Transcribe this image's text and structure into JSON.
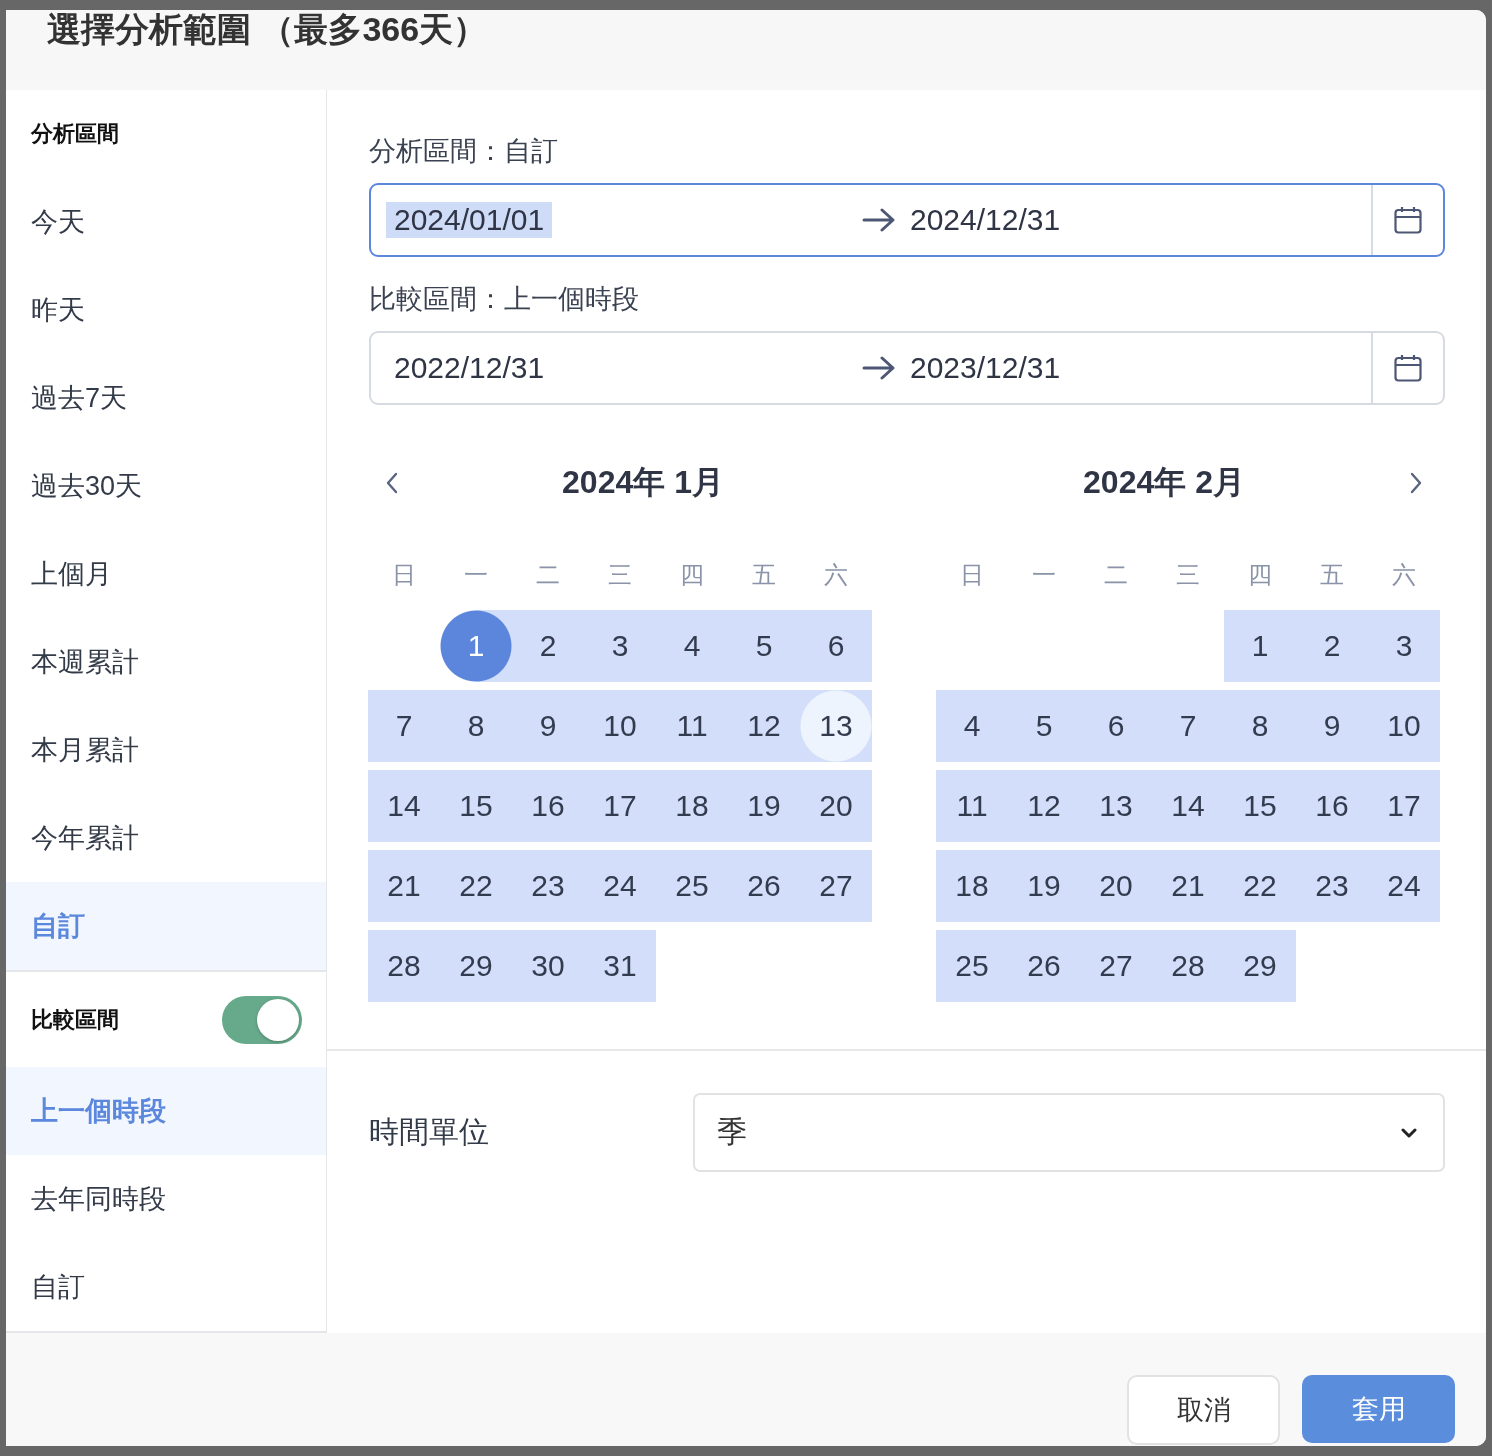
{
  "dialog": {
    "title": "選擇分析範圍 （最多366天）"
  },
  "sidebar": {
    "sections": [
      {
        "heading": "分析區間",
        "items": [
          {
            "label": "今天",
            "selected": false
          },
          {
            "label": "昨天",
            "selected": false
          },
          {
            "label": "過去7天",
            "selected": false
          },
          {
            "label": "過去30天",
            "selected": false
          },
          {
            "label": "上個月",
            "selected": false
          },
          {
            "label": "本週累計",
            "selected": false
          },
          {
            "label": "本月累計",
            "selected": false
          },
          {
            "label": "今年累計",
            "selected": false
          },
          {
            "label": "自訂",
            "selected": true
          }
        ]
      },
      {
        "heading": "比較區間",
        "toggle": {
          "on": true
        },
        "items": [
          {
            "label": "上一個時段",
            "selected": true
          },
          {
            "label": "去年同時段",
            "selected": false
          },
          {
            "label": "自訂",
            "selected": false
          }
        ]
      }
    ]
  },
  "ranges": [
    {
      "label": "分析區間：自訂",
      "start": "2024/01/01",
      "end": "2024/12/31",
      "focused": true,
      "start_selected": true
    },
    {
      "label": "比較區間：上一個時段",
      "start": "2022/12/31",
      "end": "2023/12/31",
      "focused": false,
      "start_selected": false
    }
  ],
  "calendars": [
    {
      "title": "2024年 1月",
      "weekdays": [
        "日",
        "一",
        "二",
        "三",
        "四",
        "五",
        "六"
      ],
      "weeks": [
        {
          "kind": "first",
          "days": [
            {
              "day": "1",
              "in_range": true,
              "selected": true,
              "hovered": false
            },
            {
              "day": "2",
              "in_range": true,
              "selected": false,
              "hovered": false
            },
            {
              "day": "3",
              "in_range": true,
              "selected": false,
              "hovered": false
            },
            {
              "day": "4",
              "in_range": true,
              "selected": false,
              "hovered": false
            },
            {
              "day": "5",
              "in_range": true,
              "selected": false,
              "hovered": false
            },
            {
              "day": "6",
              "in_range": true,
              "selected": false,
              "hovered": false
            }
          ]
        },
        {
          "kind": "middle",
          "days": [
            {
              "day": "7",
              "in_range": true,
              "selected": false,
              "hovered": false
            },
            {
              "day": "8",
              "in_range": true,
              "selected": false,
              "hovered": false
            },
            {
              "day": "9",
              "in_range": true,
              "selected": false,
              "hovered": false
            },
            {
              "day": "10",
              "in_range": true,
              "selected": false,
              "hovered": false
            },
            {
              "day": "11",
              "in_range": true,
              "selected": false,
              "hovered": false
            },
            {
              "day": "12",
              "in_range": true,
              "selected": false,
              "hovered": false
            },
            {
              "day": "13",
              "in_range": true,
              "selected": false,
              "hovered": true
            }
          ]
        },
        {
          "kind": "middle",
          "days": [
            {
              "day": "14",
              "in_range": true,
              "selected": false,
              "hovered": false
            },
            {
              "day": "15",
              "in_range": true,
              "selected": false,
              "hovered": false
            },
            {
              "day": "16",
              "in_range": true,
              "selected": false,
              "hovered": false
            },
            {
              "day": "17",
              "in_range": true,
              "selected": false,
              "hovered": false
            },
            {
              "day": "18",
              "in_range": true,
              "selected": false,
              "hovered": false
            },
            {
              "day": "19",
              "in_range": true,
              "selected": false,
              "hovered": false
            },
            {
              "day": "20",
              "in_range": true,
              "selected": false,
              "hovered": false
            }
          ]
        },
        {
          "kind": "middle",
          "days": [
            {
              "day": "21",
              "in_range": true,
              "selected": false,
              "hovered": false
            },
            {
              "day": "22",
              "in_range": true,
              "selected": false,
              "hovered": false
            },
            {
              "day": "23",
              "in_range": true,
              "selected": false,
              "hovered": false
            },
            {
              "day": "24",
              "in_range": true,
              "selected": false,
              "hovered": false
            },
            {
              "day": "25",
              "in_range": true,
              "selected": false,
              "hovered": false
            },
            {
              "day": "26",
              "in_range": true,
              "selected": false,
              "hovered": false
            },
            {
              "day": "27",
              "in_range": true,
              "selected": false,
              "hovered": false
            }
          ]
        },
        {
          "kind": "last",
          "days": [
            {
              "day": "28",
              "in_range": true,
              "selected": false,
              "hovered": false
            },
            {
              "day": "29",
              "in_range": true,
              "selected": false,
              "hovered": false
            },
            {
              "day": "30",
              "in_range": true,
              "selected": false,
              "hovered": false
            },
            {
              "day": "31",
              "in_range": true,
              "selected": false,
              "hovered": false
            }
          ]
        }
      ]
    },
    {
      "title": "2024年 2月",
      "weekdays": [
        "日",
        "一",
        "二",
        "三",
        "四",
        "五",
        "六"
      ],
      "weeks": [
        {
          "kind": "first",
          "days": [
            {
              "day": "1",
              "in_range": true,
              "selected": false,
              "hovered": false
            },
            {
              "day": "2",
              "in_range": true,
              "selected": false,
              "hovered": false
            },
            {
              "day": "3",
              "in_range": true,
              "selected": false,
              "hovered": false
            }
          ]
        },
        {
          "kind": "middle",
          "days": [
            {
              "day": "4",
              "in_range": true,
              "selected": false,
              "hovered": false
            },
            {
              "day": "5",
              "in_range": true,
              "selected": false,
              "hovered": false
            },
            {
              "day": "6",
              "in_range": true,
              "selected": false,
              "hovered": false
            },
            {
              "day": "7",
              "in_range": true,
              "selected": false,
              "hovered": false
            },
            {
              "day": "8",
              "in_range": true,
              "selected": false,
              "hovered": false
            },
            {
              "day": "9",
              "in_range": true,
              "selected": false,
              "hovered": false
            },
            {
              "day": "10",
              "in_range": true,
              "selected": false,
              "hovered": false
            }
          ]
        },
        {
          "kind": "middle",
          "days": [
            {
              "day": "11",
              "in_range": true,
              "selected": false,
              "hovered": false
            },
            {
              "day": "12",
              "in_range": true,
              "selected": false,
              "hovered": false
            },
            {
              "day": "13",
              "in_range": true,
              "selected": false,
              "hovered": false
            },
            {
              "day": "14",
              "in_range": true,
              "selected": false,
              "hovered": false
            },
            {
              "day": "15",
              "in_range": true,
              "selected": false,
              "hovered": false
            },
            {
              "day": "16",
              "in_range": true,
              "selected": false,
              "hovered": false
            },
            {
              "day": "17",
              "in_range": true,
              "selected": false,
              "hovered": false
            }
          ]
        },
        {
          "kind": "middle",
          "days": [
            {
              "day": "18",
              "in_range": true,
              "selected": false,
              "hovered": false
            },
            {
              "day": "19",
              "in_range": true,
              "selected": false,
              "hovered": false
            },
            {
              "day": "20",
              "in_range": true,
              "selected": false,
              "hovered": false
            },
            {
              "day": "21",
              "in_range": true,
              "selected": false,
              "hovered": false
            },
            {
              "day": "22",
              "in_range": true,
              "selected": false,
              "hovered": false
            },
            {
              "day": "23",
              "in_range": true,
              "selected": false,
              "hovered": false
            },
            {
              "day": "24",
              "in_range": true,
              "selected": false,
              "hovered": false
            }
          ]
        },
        {
          "kind": "last",
          "days": [
            {
              "day": "25",
              "in_range": true,
              "selected": false,
              "hovered": false
            },
            {
              "day": "26",
              "in_range": true,
              "selected": false,
              "hovered": false
            },
            {
              "day": "27",
              "in_range": true,
              "selected": false,
              "hovered": false
            },
            {
              "day": "28",
              "in_range": true,
              "selected": false,
              "hovered": false
            },
            {
              "day": "29",
              "in_range": true,
              "selected": false,
              "hovered": false
            }
          ]
        }
      ]
    }
  ],
  "time_unit": {
    "label": "時間單位",
    "value": "季"
  },
  "buttons": [
    {
      "label": "取消",
      "kind": "secondary"
    },
    {
      "label": "套用",
      "kind": "primary"
    }
  ]
}
